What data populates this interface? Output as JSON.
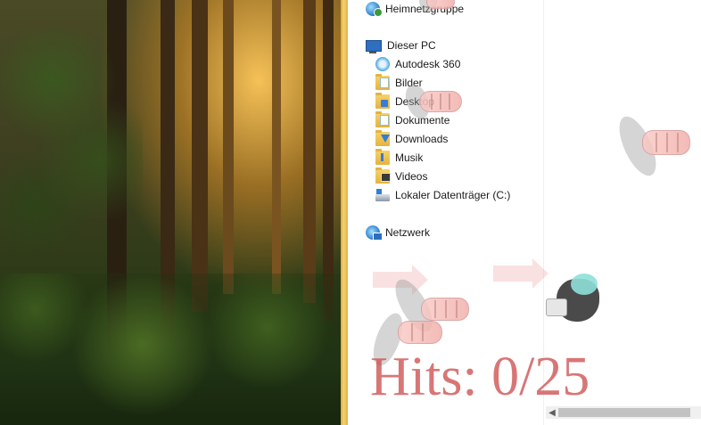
{
  "navigation": {
    "homegroup": "Heimnetzgruppe",
    "this_pc": "Dieser PC",
    "items": [
      {
        "label": "Autodesk 360",
        "icon": "autodesk-360-icon"
      },
      {
        "label": "Bilder",
        "icon": "pictures-folder-icon"
      },
      {
        "label": "Desktop",
        "icon": "desktop-folder-icon"
      },
      {
        "label": "Dokumente",
        "icon": "documents-folder-icon"
      },
      {
        "label": "Downloads",
        "icon": "downloads-folder-icon"
      },
      {
        "label": "Musik",
        "icon": "music-folder-icon"
      },
      {
        "label": "Videos",
        "icon": "videos-folder-icon"
      },
      {
        "label": "Lokaler Datenträger (C:)",
        "icon": "local-disk-icon"
      }
    ],
    "network": "Netzwerk"
  },
  "game": {
    "hits_text": "Hits: 0/25",
    "hits": 0,
    "target": 25
  },
  "colors": {
    "hits_text": "#cd5050",
    "window_edge": "#e0b24a",
    "scroll_thumb": "#c2c2c2"
  }
}
